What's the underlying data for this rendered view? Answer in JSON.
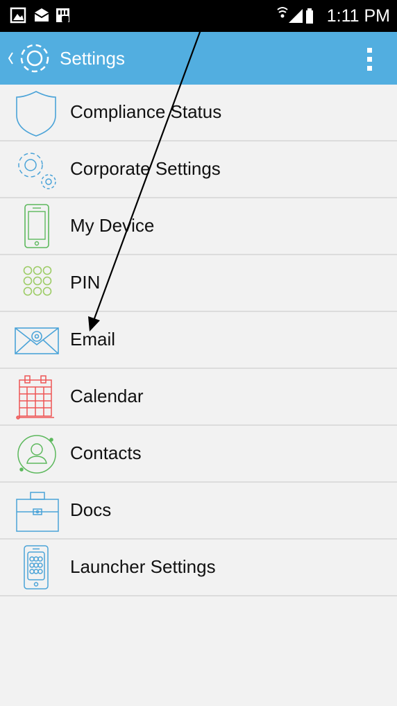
{
  "status_bar": {
    "time": "1:11 PM"
  },
  "app_bar": {
    "title": "Settings"
  },
  "menu_items": [
    {
      "label": "Compliance Status",
      "icon": "shield-icon"
    },
    {
      "label": "Corporate Settings",
      "icon": "gears-icon"
    },
    {
      "label": "My Device",
      "icon": "phone-icon"
    },
    {
      "label": "PIN",
      "icon": "keypad-icon"
    },
    {
      "label": "Email",
      "icon": "envelope-icon"
    },
    {
      "label": "Calendar",
      "icon": "calendar-icon"
    },
    {
      "label": "Contacts",
      "icon": "person-icon"
    },
    {
      "label": "Docs",
      "icon": "briefcase-icon"
    },
    {
      "label": "Launcher Settings",
      "icon": "launcher-icon"
    }
  ],
  "colors": {
    "app_bar": "#52aee0",
    "status_bar": "#000000",
    "background": "#f2f2f2",
    "divider": "#dcdcdc",
    "icon_blue": "#4aa3d8",
    "icon_green": "#5cb85c",
    "icon_lime": "#9ccc65",
    "icon_red": "#ee5555"
  }
}
